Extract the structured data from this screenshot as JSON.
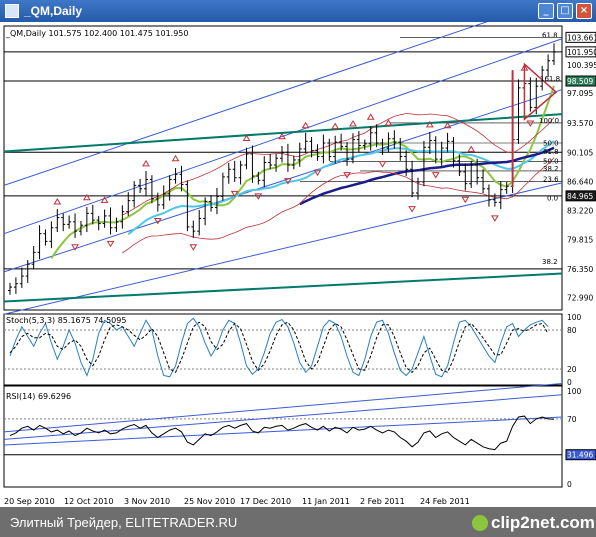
{
  "window": {
    "title": "_QM,Daily",
    "buttons": [
      "_",
      "□",
      "×"
    ]
  },
  "footer": {
    "credit": "Элитный Трейдер, ELITETRADER.RU",
    "logo": "clip2net.com"
  },
  "colors": {
    "price_bars": "#000000",
    "channel": "#3b5bd6",
    "horizontal": "#000000",
    "teal_line": "#007a6a",
    "ma_green": "#8cc63f",
    "ma_cyan": "#4fc7e6",
    "ma_navy": "#1c1c8c",
    "bollinger": "#c0303a",
    "fractals": "#c0303a",
    "stoch_main": "#2a7fc0",
    "stoch_signal": "#000000",
    "rsi": "#000000",
    "rsi_channel": "#3b5bd6",
    "label_box": "#2a7a5a"
  },
  "chart_data": [
    {
      "type": "line",
      "panel": "price",
      "title": "_QM,Daily  101.575 102.400 101.475 101.950",
      "x_labels": [
        "20 Sep 2010",
        "12 Oct 2010",
        "3 Nov 2010",
        "25 Nov 2010",
        "17 Dec 2010",
        "11 Jan 2011",
        "2 Feb 2011",
        "24 Feb 2011"
      ],
      "y_ticks": [
        103.66,
        101.95,
        100.395,
        98.509,
        97.095,
        93.57,
        90.105,
        86.64,
        84.965,
        83.22,
        79.815,
        76.35,
        72.99
      ],
      "y_ticks_text": [
        "103.661",
        "101.950",
        "100.395",
        "98.509",
        "97.095",
        "93.570",
        "90.105",
        "86.640",
        "84.965",
        "83.220",
        "79.815",
        "76.350",
        "72.990"
      ],
      "fib_levels": [
        "61.8",
        "161.8",
        "100.0",
        "50.0",
        "61.8",
        "50.0",
        "38.2",
        "23.6",
        "0.0",
        "38.2"
      ],
      "close": [
        74.2,
        74.6,
        75.5,
        76.9,
        78.3,
        80.5,
        79.6,
        81.2,
        82.4,
        81.6,
        81.9,
        80.8,
        81.5,
        82.9,
        82.1,
        81.7,
        82.6,
        81.2,
        81.9,
        83.1,
        84.4,
        86.2,
        85.8,
        86.9,
        84.6,
        83.9,
        85.2,
        86.9,
        87.5,
        86.3,
        81.3,
        80.8,
        82.3,
        84.3,
        83.6,
        84.9,
        87.2,
        88.1,
        87.1,
        88.6,
        89.9,
        87.3,
        86.8,
        88.9,
        88.6,
        89.4,
        90.1,
        88.6,
        89.2,
        90.5,
        91.4,
        90.3,
        89.6,
        91.2,
        89.6,
        91.3,
        90.8,
        89.3,
        91.6,
        90.9,
        91.1,
        92.4,
        91.2,
        90.6,
        91.7,
        91.3,
        89.6,
        88.1,
        85.3,
        86.6,
        90.7,
        91.5,
        89.3,
        90.6,
        91.4,
        89.1,
        87.8,
        86.4,
        88.6,
        87.1,
        85.8,
        84.5,
        84.2,
        85.7,
        86.1,
        91.6,
        97.7,
        98.2,
        95.4,
        97.9,
        99.8,
        100.9,
        101.95
      ]
    },
    {
      "type": "line",
      "panel": "stochastic",
      "title": "Stoch(5,3,3) 85.1675 74.5095",
      "y_ticks": [
        "100",
        "80",
        "20",
        "0"
      ],
      "series": [
        {
          "values": [
            40,
            65,
            85,
            70,
            55,
            75,
            90,
            60,
            35,
            55,
            80,
            60,
            30,
            10,
            35,
            75,
            95,
            90,
            80,
            85,
            70,
            55,
            75,
            95,
            80,
            40,
            10,
            8,
            25,
            60,
            90,
            98,
            85,
            60,
            40,
            55,
            80,
            95,
            90,
            60,
            25,
            12,
            20,
            45,
            75,
            92,
            96,
            85,
            60,
            30,
            15,
            25,
            55,
            85,
            95,
            90,
            70,
            40,
            15,
            10,
            35,
            70,
            92,
            95,
            75,
            45,
            18,
            10,
            20,
            45,
            70,
            40,
            12,
            8,
            25,
            60,
            92,
            95,
            85,
            70,
            55,
            40,
            30,
            60,
            85,
            90,
            70,
            80,
            88,
            92,
            95,
            85.2
          ]
        },
        {
          "values": [
            45,
            55,
            70,
            75,
            68,
            68,
            75,
            72,
            55,
            50,
            60,
            65,
            55,
            35,
            25,
            40,
            65,
            85,
            88,
            85,
            80,
            72,
            65,
            72,
            82,
            70,
            45,
            20,
            15,
            35,
            60,
            85,
            92,
            85,
            62,
            50,
            58,
            78,
            90,
            82,
            58,
            32,
            18,
            28,
            48,
            72,
            88,
            92,
            80,
            58,
            32,
            20,
            30,
            55,
            80,
            90,
            85,
            65,
            42,
            20,
            18,
            40,
            68,
            88,
            88,
            70,
            45,
            22,
            15,
            25,
            45,
            52,
            35,
            18,
            15,
            35,
            62,
            85,
            90,
            80,
            68,
            55,
            42,
            42,
            60,
            80,
            82,
            78,
            82,
            88,
            90,
            74.5
          ]
        }
      ]
    },
    {
      "type": "line",
      "panel": "rsi",
      "title": "RSI(14) 69.6296",
      "y_ticks": [
        "100",
        "70",
        "31.496",
        "0"
      ],
      "series": [
        {
          "values": [
            52,
            55,
            60,
            62,
            58,
            63,
            60,
            56,
            58,
            54,
            57,
            52,
            55,
            60,
            57,
            55,
            58,
            54,
            55,
            59,
            62,
            64,
            60,
            63,
            55,
            50,
            54,
            58,
            60,
            56,
            45,
            42,
            48,
            54,
            52,
            56,
            61,
            63,
            60,
            63,
            65,
            57,
            55,
            61,
            60,
            62,
            63,
            58,
            60,
            63,
            65,
            61,
            58,
            62,
            57,
            61,
            59,
            55,
            61,
            58,
            59,
            62,
            58,
            55,
            58,
            56,
            50,
            46,
            40,
            45,
            55,
            57,
            50,
            54,
            56,
            50,
            46,
            42,
            48,
            44,
            40,
            38,
            37,
            44,
            46,
            62,
            72,
            73,
            65,
            70,
            72,
            70,
            69.6
          ]
        }
      ]
    }
  ]
}
